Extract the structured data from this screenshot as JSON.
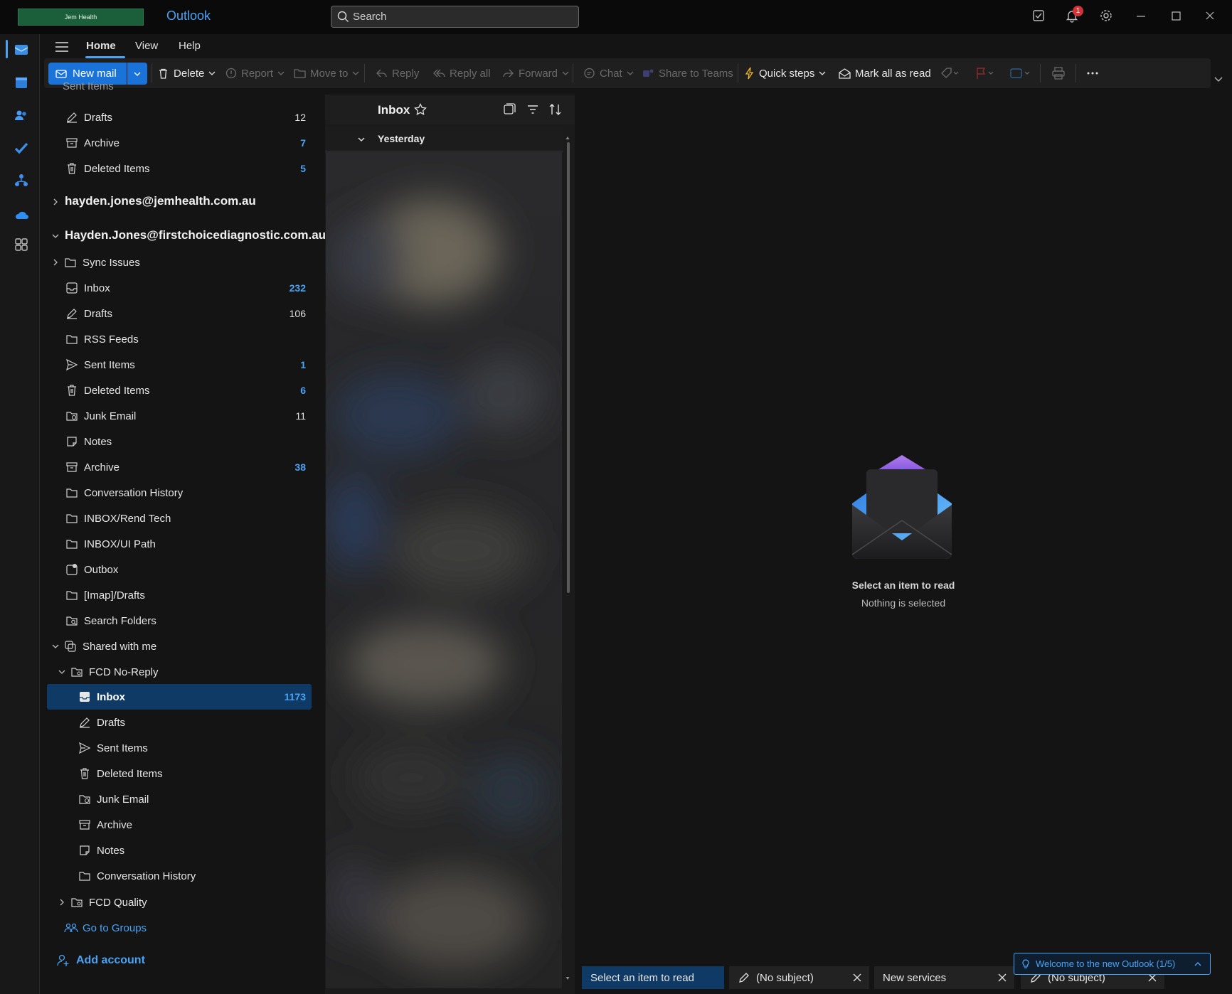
{
  "titlebar": {
    "logo_text": "Jem Health",
    "app_title": "Outlook",
    "search_placeholder": "Search",
    "notification_count": "1"
  },
  "ribbon": {
    "tabs": [
      "Home",
      "View",
      "Help"
    ],
    "new_mail": "New mail",
    "delete": "Delete",
    "report": "Report",
    "move_to": "Move to",
    "reply": "Reply",
    "reply_all": "Reply all",
    "forward": "Forward",
    "chat": "Chat",
    "share_to_teams": "Share to Teams",
    "quick_steps": "Quick steps",
    "mark_all_read": "Mark all as read"
  },
  "folders": {
    "top_partial": "Sent Items",
    "account1": [
      {
        "name": "Drafts",
        "count": "12",
        "blue": false
      },
      {
        "name": "Archive",
        "count": "7",
        "blue": true
      },
      {
        "name": "Deleted Items",
        "count": "5",
        "blue": true
      }
    ],
    "account2_email": "hayden.jones@jemhealth.com.au",
    "account3_email": "Hayden.Jones@firstchoicediagnostic.com.au",
    "account3": [
      {
        "name": "Sync Issues",
        "count": "",
        "blue": false
      },
      {
        "name": "Inbox",
        "count": "232",
        "blue": true
      },
      {
        "name": "Drafts",
        "count": "106",
        "blue": false
      },
      {
        "name": "RSS Feeds",
        "count": "",
        "blue": false
      },
      {
        "name": "Sent Items",
        "count": "1",
        "blue": true
      },
      {
        "name": "Deleted Items",
        "count": "6",
        "blue": true
      },
      {
        "name": "Junk Email",
        "count": "11",
        "blue": false
      },
      {
        "name": "Notes",
        "count": "",
        "blue": false
      },
      {
        "name": "Archive",
        "count": "38",
        "blue": true
      },
      {
        "name": "Conversation History",
        "count": "",
        "blue": false
      },
      {
        "name": "INBOX/Rend Tech",
        "count": "",
        "blue": false
      },
      {
        "name": "INBOX/UI Path",
        "count": "",
        "blue": false
      },
      {
        "name": "Outbox",
        "count": "",
        "blue": false
      },
      {
        "name": "[Imap]/Drafts",
        "count": "",
        "blue": false
      },
      {
        "name": "Search Folders",
        "count": "",
        "blue": false
      }
    ],
    "shared_with_me": "Shared with me",
    "fcd_noreply": "FCD No-Reply",
    "noreply_folders": [
      {
        "name": "Inbox",
        "count": "1173",
        "blue": true
      },
      {
        "name": "Drafts",
        "count": "",
        "blue": false
      },
      {
        "name": "Sent Items",
        "count": "",
        "blue": false
      },
      {
        "name": "Deleted Items",
        "count": "",
        "blue": false
      },
      {
        "name": "Junk Email",
        "count": "",
        "blue": false
      },
      {
        "name": "Archive",
        "count": "",
        "blue": false
      },
      {
        "name": "Notes",
        "count": "",
        "blue": false
      },
      {
        "name": "Conversation History",
        "count": "",
        "blue": false
      }
    ],
    "fcd_quality": "FCD Quality",
    "go_to_groups": "Go to Groups",
    "add_account": "Add account"
  },
  "message_list": {
    "title": "Inbox",
    "group_label": "Yesterday"
  },
  "reading_pane": {
    "empty_title": "Select an item to read",
    "empty_subtitle": "Nothing is selected"
  },
  "bottom_tabs": {
    "tab1": "Select an item to read",
    "tab2": "(No subject)",
    "tab3": "New services",
    "tab4": "(No subject)",
    "welcome": "Welcome to the new Outlook  (1/5)"
  },
  "colors": {
    "accent": "#4aa3f5",
    "primary_button": "#1a73d8",
    "selected_row": "#0f3a66",
    "badge": "#d13438"
  }
}
